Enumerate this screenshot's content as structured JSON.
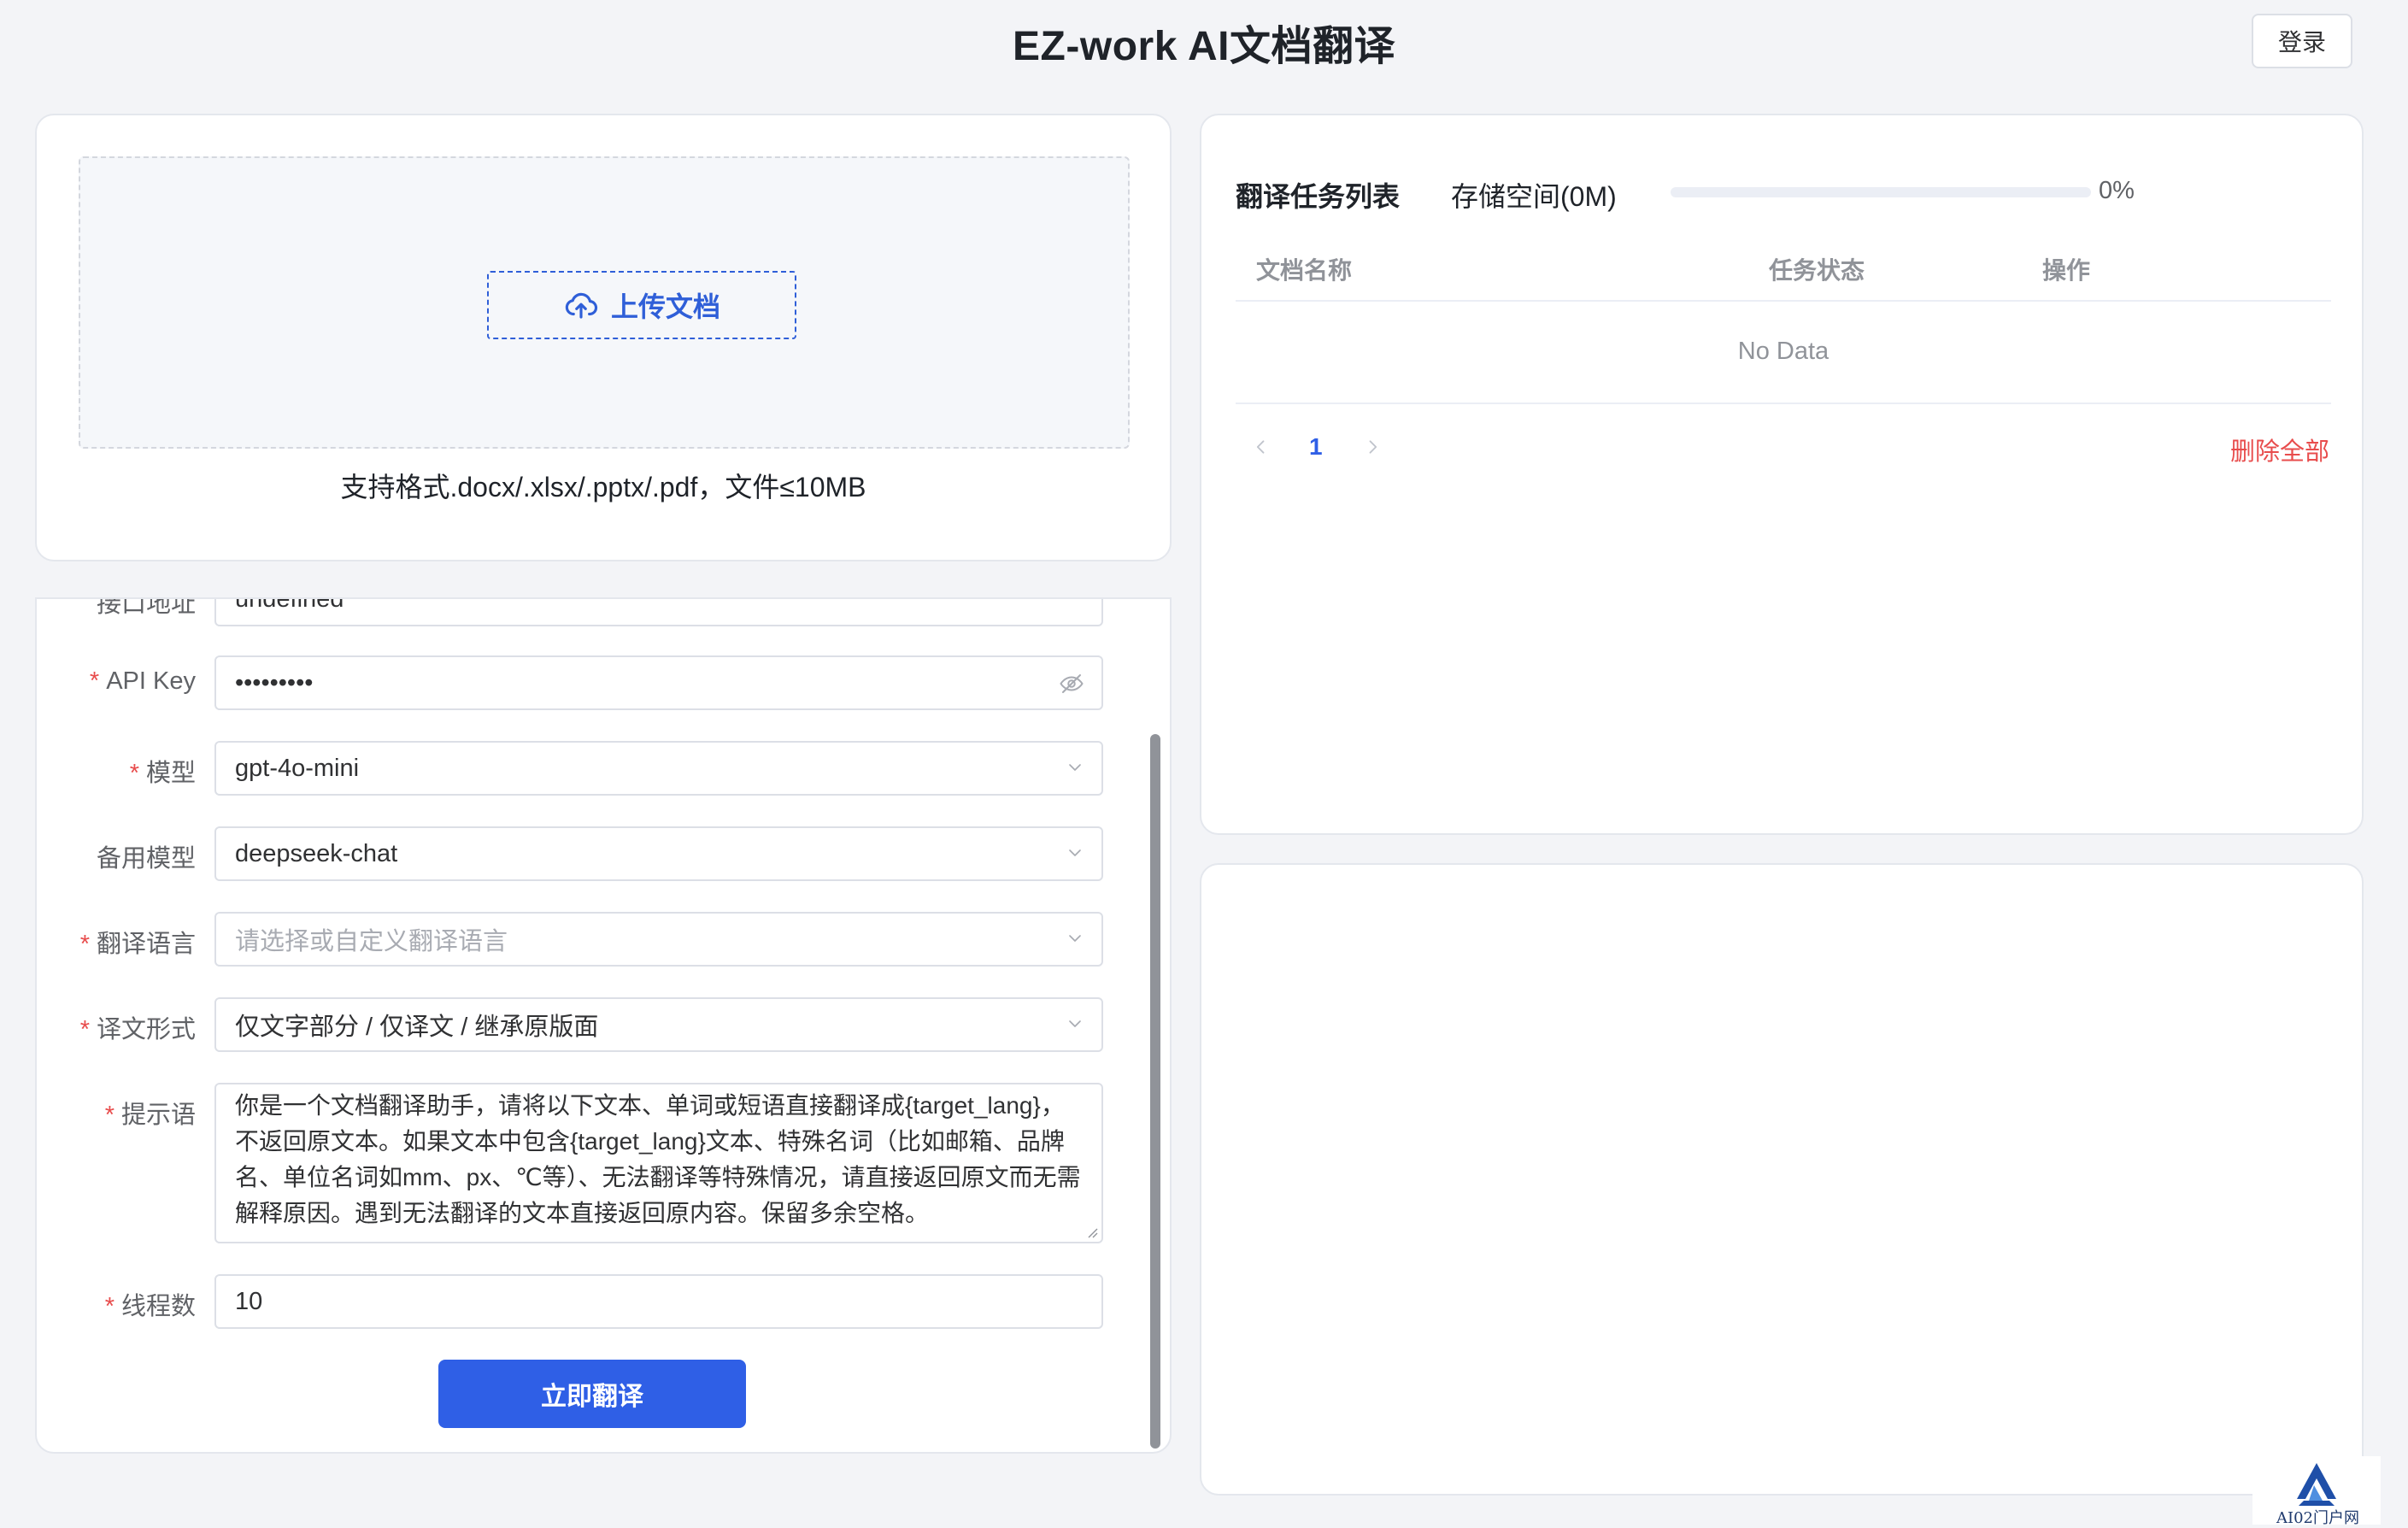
{
  "header": {
    "title": "EZ-work AI文档翻译",
    "login_label": "登录"
  },
  "upload": {
    "button_label": "上传文档",
    "format_hint": "支持格式.docx/.xlsx/.pptx/.pdf，文件≤10MB"
  },
  "form": {
    "api_address": {
      "label": "接口地址",
      "value": "undefined"
    },
    "api_key": {
      "label": "API Key",
      "value": "•••••••••",
      "required": true
    },
    "model": {
      "label": "模型",
      "value": "gpt-4o-mini",
      "required": true
    },
    "backup_model": {
      "label": "备用模型",
      "value": "deepseek-chat"
    },
    "target_lang": {
      "label": "翻译语言",
      "placeholder": "请选择或自定义翻译语言",
      "required": true
    },
    "output_format": {
      "label": "译文形式",
      "value": "仅文字部分 / 仅译文 / 继承原版面",
      "required": true
    },
    "prompt": {
      "label": "提示语",
      "required": true,
      "value": "你是一个文档翻译助手，请将以下文本、单词或短语直接翻译成{target_lang}，不返回原文本。如果文本中包含{target_lang}文本、特殊名词（比如邮箱、品牌名、单位名词如mm、px、℃等）、无法翻译等特殊情况，请直接返回原文而无需解释原因。遇到无法翻译的文本直接返回原内容。保留多余空格。"
    },
    "threads": {
      "label": "线程数",
      "value": "10",
      "required": true
    },
    "submit_label": "立即翻译"
  },
  "tasks": {
    "title": "翻译任务列表",
    "storage_label": "存储空间(0M)",
    "storage_percent": 0,
    "storage_percent_label": "0%",
    "columns": [
      "文档名称",
      "任务状态",
      "操作"
    ],
    "empty_text": "No Data",
    "current_page": "1",
    "delete_all_label": "删除全部"
  },
  "watermark": {
    "text": "AI02门户网"
  },
  "colors": {
    "primary": "#2f5fe6",
    "danger": "#e84d4d",
    "page_bg": "#f3f4f7"
  }
}
